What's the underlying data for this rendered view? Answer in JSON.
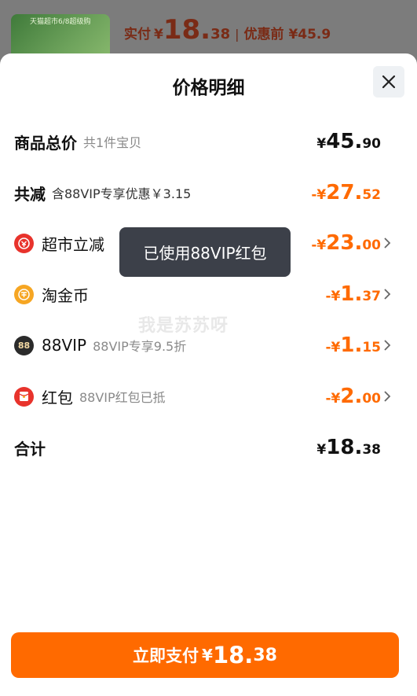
{
  "top": {
    "thumb_caption": "天猫超市6/8超级购",
    "pay_label": "实付",
    "yen": "¥",
    "pay_int": "18.",
    "pay_dec": "38",
    "separator": "|",
    "orig_label": "优惠前 ¥45.9"
  },
  "sheet": {
    "title": "价格明细",
    "rows": {
      "total": {
        "label": "商品总价",
        "sub": "共1件宝贝",
        "yen": "¥",
        "int": "45.",
        "dec": "90"
      },
      "reduce": {
        "label": "共减",
        "sub": "含88VIP专享优惠￥3.15",
        "yen": "-¥",
        "int": "27.",
        "dec": "52"
      },
      "supermarket": {
        "label": "超市立减",
        "yen": "-¥",
        "int": "23.",
        "dec": "00"
      },
      "coin": {
        "label": "淘金币",
        "yen": "-¥",
        "int": "1.",
        "dec": "37"
      },
      "vip": {
        "label": "88VIP",
        "sub": "88VIP专享9.5折",
        "icon_text": "88",
        "yen": "-¥",
        "int": "1.",
        "dec": "15"
      },
      "redpacket": {
        "label": "红包",
        "sub": "88VIP红包已抵",
        "yen": "-¥",
        "int": "2.",
        "dec": "00"
      },
      "sum": {
        "label": "合计",
        "yen": "¥",
        "int": "18.",
        "dec": "38"
      }
    },
    "toast": "已使用88VIP红包",
    "watermark": "我是苏苏呀"
  },
  "pay_button": {
    "label": "立即支付",
    "yen": "¥",
    "int": "18.",
    "dec": "38"
  },
  "colors": {
    "accent": "#ff6a00",
    "toast_bg": "#3c4049",
    "icon_red": "#e8332c",
    "icon_gold": "#f6a623",
    "icon_dark": "#2b2b2b"
  },
  "icons": {
    "close": "close-icon",
    "chevron": "chevron-right-icon",
    "supermarket": "supermarket-discount-icon",
    "coin": "gold-coin-icon",
    "vip": "vip-88-icon",
    "redpacket": "red-packet-icon"
  }
}
